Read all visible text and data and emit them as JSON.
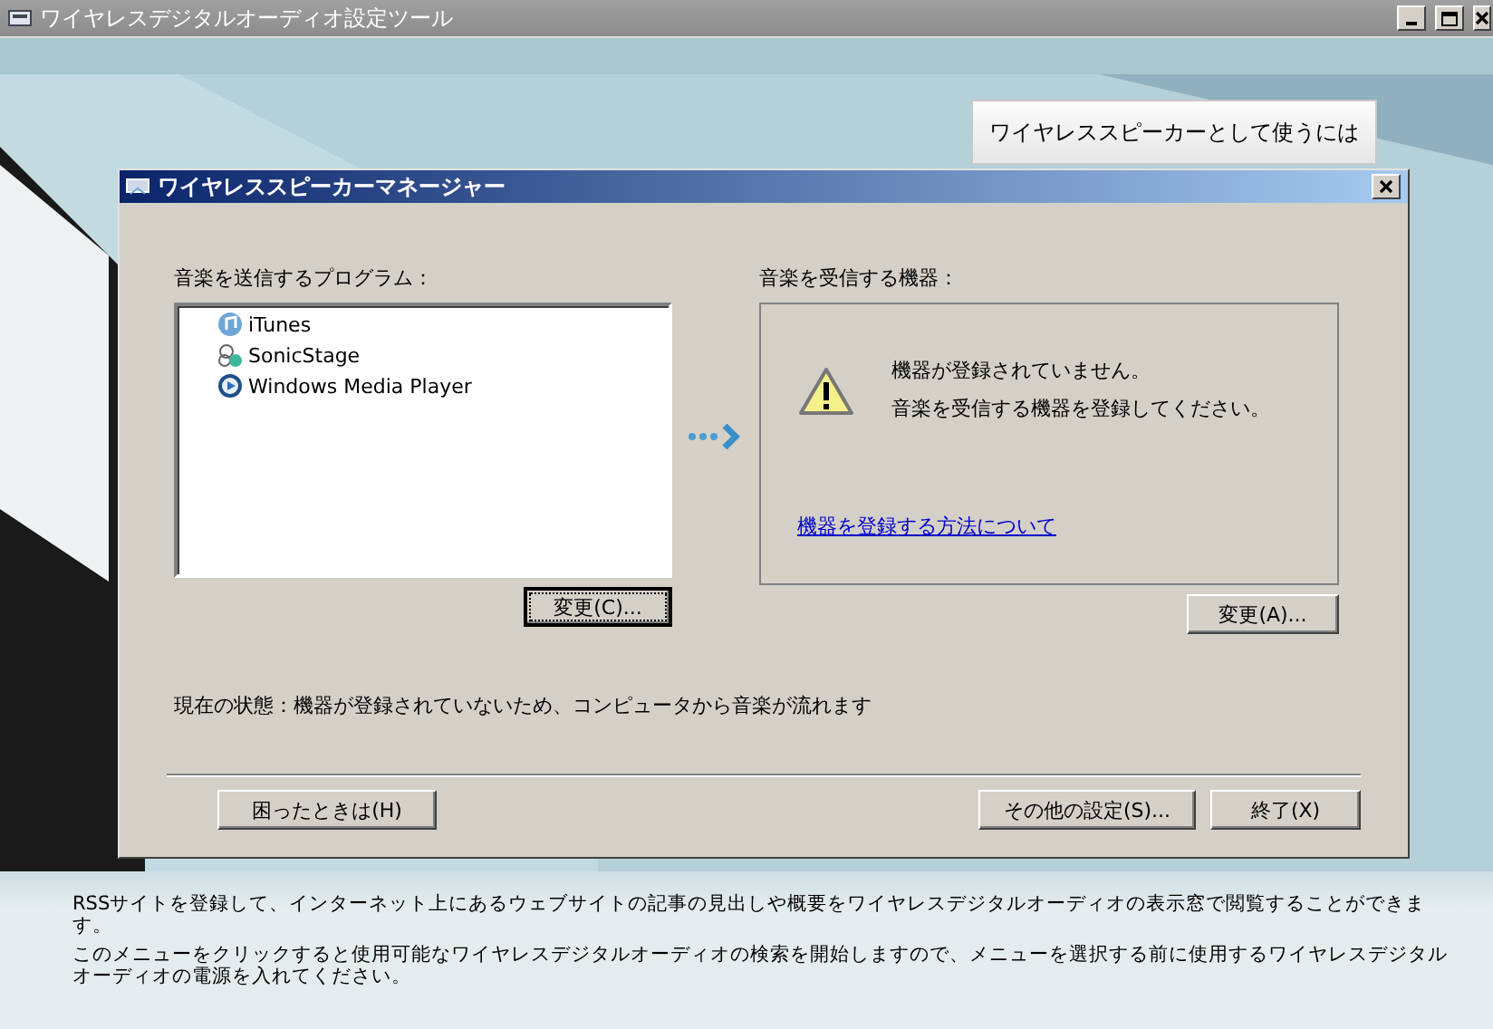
{
  "window": {
    "title": "ワイヤレスデジタルオーディオ設定ツール"
  },
  "top_button": "ワイヤレススピーカーとして使うには",
  "dialog": {
    "title": "ワイヤレススピーカーマネージャー",
    "programs": {
      "label": "音楽を送信するプログラム：",
      "items": [
        {
          "name": "iTunes",
          "kind": "itunes"
        },
        {
          "name": "SonicStage",
          "kind": "sonicstage"
        },
        {
          "name": "Windows Media Player",
          "kind": "wmp"
        }
      ],
      "button": "変更(C)..."
    },
    "devices": {
      "label": "音楽を受信する機器：",
      "messages": [
        "機器が登録されていません。",
        "音楽を受信する機器を登録してください。"
      ],
      "link": "機器を登録する方法について",
      "button": "変更(A)..."
    },
    "status": "現在の状態：機器が登録されていないため、コンピュータから音楽が流れます",
    "left_buttons": [
      "困ったときは(H)"
    ],
    "right_buttons": [
      "その他の設定(S)...",
      "終了(X)"
    ]
  },
  "info": [
    "RSSサイトを登録して、インターネット上にあるウェブサイトの記事の見出しや概要をワイヤレスデジタルオーディオの表示窓で閲覧することができます。",
    "このメニューをクリックすると使用可能なワイヤレスデジタルオーディオの検索を開始しますので、メニューを選択する前に使用するワイヤレスデジタルオーディオの電源を入れてください。"
  ]
}
